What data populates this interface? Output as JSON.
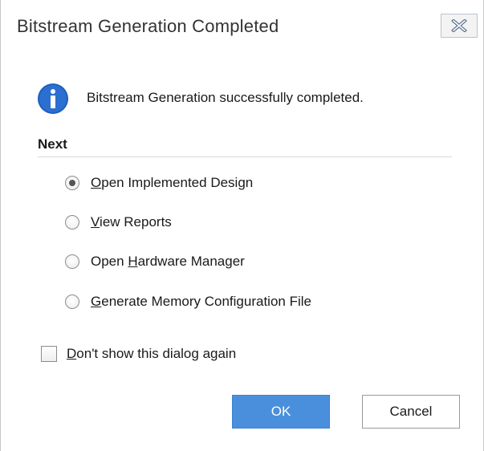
{
  "window": {
    "title": "Bitstream Generation Completed",
    "close_icon": "close-icon"
  },
  "message": {
    "icon": "info-icon",
    "text": "Bitstream Generation successfully completed."
  },
  "next": {
    "label": "Next",
    "selected": "open-implemented-design",
    "options": [
      {
        "pre": "",
        "mnemonic": "O",
        "post": "pen Implemented Design",
        "checked": true
      },
      {
        "pre": "",
        "mnemonic": "V",
        "post": "iew Reports",
        "checked": false
      },
      {
        "pre": "Open ",
        "mnemonic": "H",
        "post": "ardware Manager",
        "checked": false
      },
      {
        "pre": "",
        "mnemonic": "G",
        "post": "enerate Memory Configuration File",
        "checked": false
      }
    ]
  },
  "dont_show": {
    "mnemonic": "D",
    "post": "on't show this dialog again",
    "checked": false
  },
  "buttons": {
    "ok": "OK",
    "cancel": "Cancel"
  },
  "colors": {
    "accent": "#4a8fdc",
    "info_icon": "#1f5fbf"
  }
}
